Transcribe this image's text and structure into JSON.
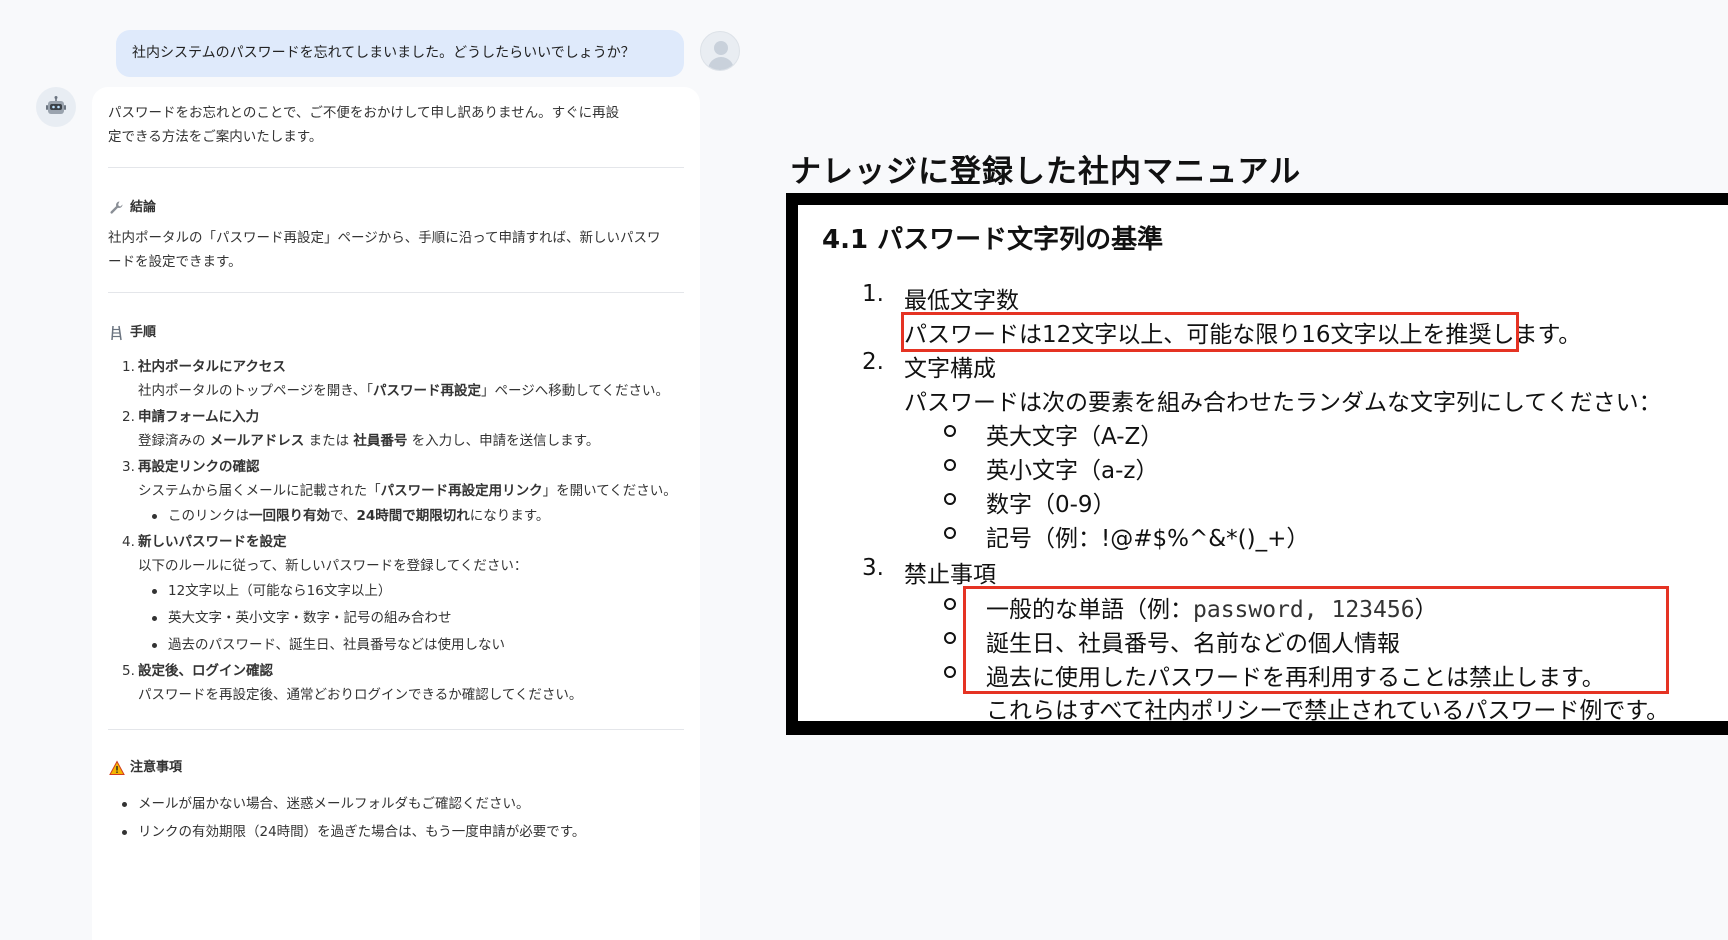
{
  "user_message": "社内システムのパスワードを忘れてしまいました。どうしたらいいでしょうか？",
  "bot": {
    "intro": "パスワードをお忘れとのことで、ご不便をおかけして申し訳ありません。すぐに再設定できる方法をご案内いたします。",
    "conclusion_title": "結論",
    "conclusion_text": "社内ポータルの「パスワード再設定」ページから、手順に沿って申請すれば、新しいパスワードを設定できます。",
    "steps_title": "手順",
    "steps": [
      {
        "num": "1.",
        "title": "社内ポータルにアクセス",
        "body_a": "社内ポータルのトップページを開き、「",
        "body_b": "パスワード再設定",
        "body_c": "」ページへ移動してください。"
      },
      {
        "num": "2.",
        "title": "申請フォームに入力",
        "body_a": "登録済みの ",
        "body_b": "メールアドレス",
        "body_c": " または ",
        "body_d": "社員番号",
        "body_e": " を入力し、申請を送信します。"
      },
      {
        "num": "3.",
        "title": "再設定リンクの確認",
        "body_a": "システムから届くメールに記載された「",
        "body_b": "パスワード再設定用リンク",
        "body_c": "」を開いてください。",
        "bullet_a": "このリンクは",
        "bullet_b": "一回限り有効",
        "bullet_c": "で、",
        "bullet_d": "24時間で期限切れ",
        "bullet_e": "になります。"
      },
      {
        "num": "4.",
        "title": "新しいパスワードを設定",
        "body": "以下のルールに従って、新しいパスワードを登録してください：",
        "bullets": [
          "12文字以上（可能なら16文字以上）",
          "英大文字・英小文字・数字・記号の組み合わせ",
          "過去のパスワード、誕生日、社員番号などは使用しない"
        ]
      },
      {
        "num": "5.",
        "title": "設定後、ログイン確認",
        "body": "パスワードを再設定後、通常どおりログインできるか確認してください。"
      }
    ],
    "notes_title": "注意事項",
    "notes": [
      "メールが届かない場合、迷惑メールフォルダもご確認ください。",
      "リンクの有効期限（24時間）を過ぎた場合は、もう一度申請が必要です。"
    ]
  },
  "manual": {
    "heading": "ナレッジに登録した社内マニュアル",
    "section_title": "4.1 パスワード文字列の基準",
    "item1_num": "1.",
    "item1_title": "最低文字数",
    "item1_text_highlight": "パスワードは12文字以上、可能な限り16文字以上を推奨",
    "item1_text_rest": "します。",
    "item2_num": "2.",
    "item2_title": "文字構成",
    "item2_text": "パスワードは次の要素を組み合わせたランダムな文字列にしてください：",
    "item2_subs": [
      "英大文字（A-Z）",
      "英小文字（a-z）",
      "数字（0-9）",
      "記号（例：!@#$%^&*()_+）"
    ],
    "item3_num": "3.",
    "item3_title": "禁止事項",
    "item3_sub1_a": "一般的な単語（例：",
    "item3_sub1_mono": "password, 123456",
    "item3_sub1_b": "）",
    "item3_sub2": "誕生日、社員番号、名前などの個人情報",
    "item3_sub3": "過去に使用したパスワードを再利用することは禁止します。",
    "item3_footer": "これらはすべて社内ポリシーで禁止されているパスワード例です。"
  },
  "colors": {
    "user_bubble": "#dfeafb",
    "highlight_box": "#e53323",
    "manual_frame": "#000000"
  },
  "icons": {
    "conclusion": "wrench-icon",
    "steps": "ladder-icon",
    "notes": "warning-icon",
    "bot": "robot-icon"
  }
}
